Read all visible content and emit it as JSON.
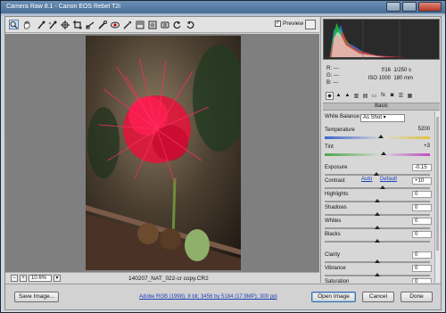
{
  "window": {
    "title": "Camera Raw 8.1  -  Canon EOS Rebel T2i"
  },
  "toolbar": {
    "tools": [
      "zoom-tool",
      "hand-tool",
      "white-balance-tool",
      "color-sampler-tool",
      "targeted-adjustment-tool",
      "crop-tool",
      "straighten-tool",
      "spot-removal-tool",
      "red-eye-tool",
      "adjustment-brush-tool",
      "graduated-filter-tool",
      "radial-filter-tool",
      "preferences-tool",
      "rotate-ccw-tool",
      "rotate-cw-tool"
    ],
    "preview_label": "Preview",
    "preview_checked": true
  },
  "status": {
    "zoom": "10.6%",
    "filename": "140207_NAT_022-cr copy.CR2"
  },
  "info": {
    "r": "R:",
    "g": "G:",
    "b": "B:",
    "r_val": "---",
    "g_val": "---",
    "b_val": "---",
    "aperture": "f/16",
    "shutter": "1/250 s",
    "iso": "ISO 1000",
    "focal": "180 mm"
  },
  "panel": {
    "section": "Basic",
    "white_balance_label": "White Balance:",
    "white_balance_value": "As Shot",
    "auto_label": "Auto",
    "default_label": "Default",
    "sliders": [
      {
        "label": "Temperature",
        "value": "5200",
        "position": 0.53
      },
      {
        "label": "Tint",
        "value": "+3",
        "position": 0.56
      },
      {
        "label": "Exposure",
        "value": "-0.15",
        "position": 0.49
      },
      {
        "label": "Contrast",
        "value": "+10",
        "position": 0.55
      },
      {
        "label": "Highlights",
        "value": "0",
        "position": 0.5
      },
      {
        "label": "Shadows",
        "value": "0",
        "position": 0.5
      },
      {
        "label": "Whites",
        "value": "0",
        "position": 0.5
      },
      {
        "label": "Blacks",
        "value": "0",
        "position": 0.5
      },
      {
        "label": "Clarity",
        "value": "0",
        "position": 0.5
      },
      {
        "label": "Vibrance",
        "value": "0",
        "position": 0.5
      },
      {
        "label": "Saturation",
        "value": "0",
        "position": 0.5
      }
    ]
  },
  "bottom": {
    "save_label": "Save Image...",
    "workflow_link": "Adobe RGB (1998); 8 bit; 3456 by 5184 (17.9MP); 300 ppi",
    "open_label": "Open Image",
    "cancel_label": "Cancel",
    "done_label": "Done"
  }
}
